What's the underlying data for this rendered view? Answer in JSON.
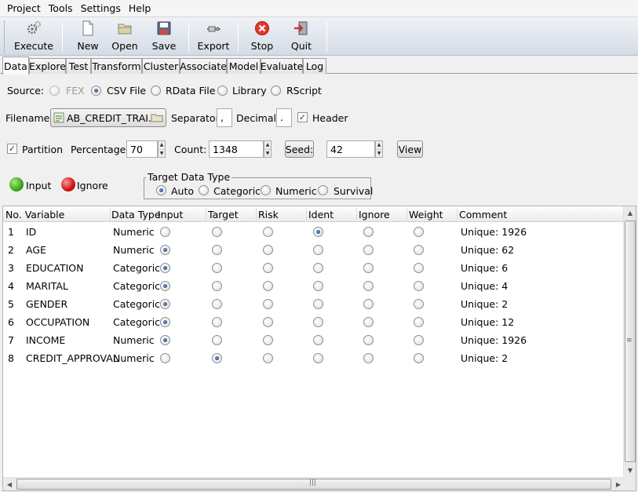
{
  "menu": [
    {
      "label": "Project"
    },
    {
      "label": "Tools"
    },
    {
      "label": "Settings"
    },
    {
      "label": "Help"
    }
  ],
  "toolbar": {
    "execute": "Execute",
    "new": "New",
    "open": "Open",
    "save": "Save",
    "export": "Export",
    "stop": "Stop",
    "quit": "Quit"
  },
  "tabs": [
    "Data",
    "Explore",
    "Test",
    "Transform",
    "Cluster",
    "Associate",
    "Model",
    "Evaluate",
    "Log"
  ],
  "tabs_visible": [
    "Data",
    "Explore",
    "Test",
    "Transform",
    "Cluster",
    "Associate",
    "Model",
    "Evaluate",
    "Log"
  ],
  "active_tab": "Data",
  "source": {
    "label": "Source:",
    "options": [
      "FEX",
      "CSV File",
      "RData File",
      "Library",
      "RScript"
    ],
    "selected": "CSV File",
    "disabled": [
      "FEX"
    ]
  },
  "file": {
    "filename_label": "Filename:",
    "filename": "AB_CREDIT_TRAI...",
    "separator_label": "Separator:",
    "separator": ",",
    "decimal_label": "Decimal:",
    "decimal": ".",
    "header_label": "Header",
    "header_checked": true
  },
  "partition": {
    "label": "Partition",
    "checked": true,
    "percentage_label": "Percentage:",
    "percentage": "70",
    "count_label": "Count:",
    "count": "1348",
    "seed_label": "Seed:",
    "seed": "42",
    "view_label": "View"
  },
  "legend": {
    "input": "Input",
    "ignore": "Ignore"
  },
  "target_type": {
    "title": "Target Data Type",
    "options": [
      "Auto",
      "Categoric",
      "Numeric",
      "Survival"
    ],
    "selected": "Auto"
  },
  "table": {
    "headers": {
      "no_var": "No. Variable",
      "dtype": "Data Type",
      "input": "Input",
      "target": "Target",
      "risk": "Risk",
      "ident": "Ident",
      "ignore": "Ignore",
      "weight": "Weight",
      "comment": "Comment"
    },
    "rows": [
      {
        "no": "1",
        "variable": "ID",
        "dtype": "Numeric",
        "role": "ident",
        "comment": "Unique: 1926"
      },
      {
        "no": "2",
        "variable": "AGE",
        "dtype": "Numeric",
        "role": "input",
        "comment": "Unique: 62"
      },
      {
        "no": "3",
        "variable": "EDUCATION",
        "dtype": "Categoric",
        "role": "input",
        "comment": "Unique: 6"
      },
      {
        "no": "4",
        "variable": "MARITAL",
        "dtype": "Categoric",
        "role": "input",
        "comment": "Unique: 4"
      },
      {
        "no": "5",
        "variable": "GENDER",
        "dtype": "Categoric",
        "role": "input",
        "comment": "Unique: 2"
      },
      {
        "no": "6",
        "variable": "OCCUPATION",
        "dtype": "Categoric",
        "role": "input",
        "comment": "Unique: 12"
      },
      {
        "no": "7",
        "variable": "INCOME",
        "dtype": "Numeric",
        "role": "input",
        "comment": "Unique: 1926"
      },
      {
        "no": "8",
        "variable": "CREDIT_APPROVAL",
        "dtype": "Numeric",
        "role": "target",
        "comment": "Unique: 2"
      }
    ]
  },
  "colors": {
    "input_dot": "#3aa51d",
    "ignore_dot": "#d11010",
    "toolbar_bg": "#d5dbe6"
  }
}
